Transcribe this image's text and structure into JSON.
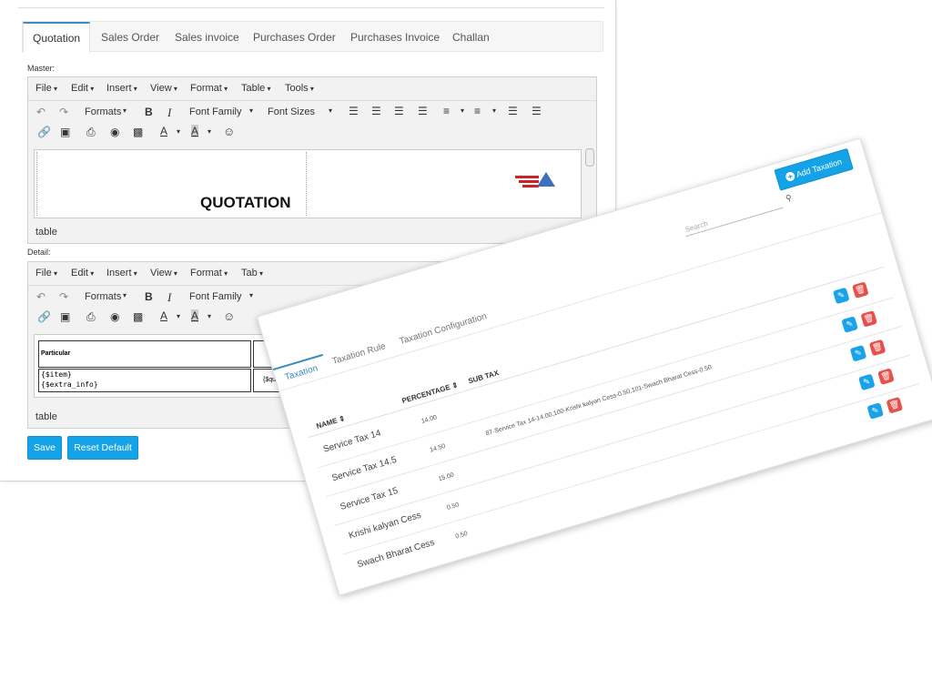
{
  "tabs": [
    "Quotation",
    "Sales Order",
    "Sales invoice",
    "Purchases Order",
    "Purchases Invoice",
    "Challan"
  ],
  "master_label": "Master:",
  "detail_label": "Detail:",
  "menus": [
    "File",
    "Edit",
    "Insert",
    "View",
    "Format",
    "Table",
    "Tools"
  ],
  "detail_menus": [
    "File",
    "Edit",
    "Insert",
    "View",
    "Format",
    "Tab"
  ],
  "toolbar": {
    "formats": "Formats",
    "bold": "B",
    "italic": "I",
    "font_family": "Font Family",
    "font_sizes": "Font Sizes"
  },
  "master_doc_title": "QUOTATION",
  "statusbar": "table",
  "detail_table": {
    "particular": "Particular",
    "qty_header": "Q",
    "item": "{$item}",
    "extra": "{$extra_info}",
    "quantity": "{$quanti"
  },
  "buttons": {
    "save": "Save",
    "reset": "Reset Default"
  },
  "taxation": {
    "tabs": [
      "Taxation",
      "Taxation Rule",
      "Taxation Configuration"
    ],
    "add_button": "Add Taxation",
    "search_placeholder": "Search",
    "headers": {
      "name": "NAME",
      "percentage": "PERCENTAGE",
      "subtax": "SUB TAX"
    },
    "rows": [
      {
        "name": "Service Tax 14",
        "percentage": "14.00",
        "subtax": ""
      },
      {
        "name": "Service Tax 14.5",
        "percentage": "14.50",
        "subtax": "87-Service Tax 14-14.00,100-Krishi kalyan Cess-0.50,101-Swach Bharat Cess-0.50"
      },
      {
        "name": "Service Tax 15",
        "percentage": "15.00",
        "subtax": ""
      },
      {
        "name": "Krishi kalyan Cess",
        "percentage": "0.50",
        "subtax": ""
      },
      {
        "name": "Swach Bharat Cess",
        "percentage": "0.50",
        "subtax": ""
      }
    ]
  },
  "colors": {
    "accent": "#13a3e6",
    "delete": "#e8504a",
    "tab_active": "#3c8dbc"
  },
  "icons": [
    "undo-icon",
    "redo-icon",
    "link-icon",
    "image-icon",
    "print-icon",
    "preview-icon",
    "media-icon",
    "text-color-icon",
    "bg-color-icon",
    "emoticon-icon",
    "align-left-icon",
    "align-center-icon",
    "align-right-icon",
    "justify-icon",
    "bullet-list-icon",
    "number-list-icon",
    "outdent-icon",
    "indent-icon",
    "search-icon",
    "plus-circle-icon",
    "pencil-icon",
    "trash-icon"
  ]
}
